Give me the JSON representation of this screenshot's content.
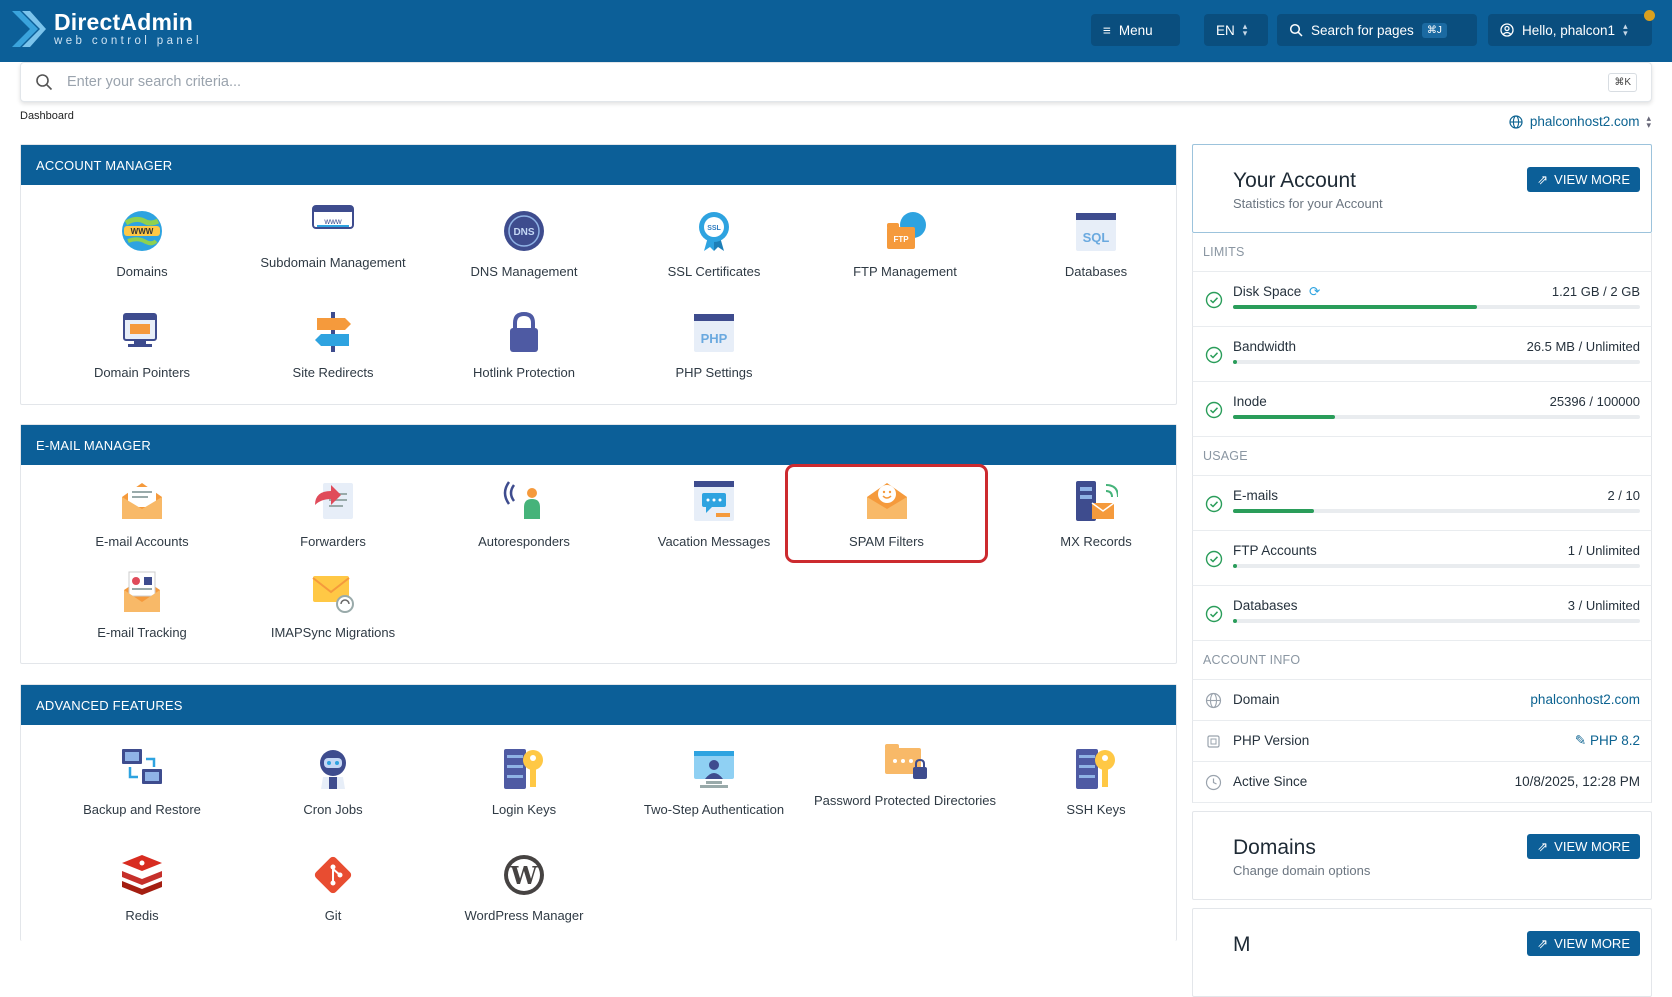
{
  "brand": {
    "name": "DirectAdmin",
    "tagline": "web control panel"
  },
  "topbar": {
    "menu_label": "Menu",
    "lang": "EN",
    "search_label": "Search for pages",
    "search_shortcut": "⌘J",
    "user_label": "Hello, phalcon1"
  },
  "search": {
    "placeholder": "Enter your search criteria...",
    "shortcut": "⌘K"
  },
  "breadcrumb": "Dashboard",
  "domain_select": "phalconhost2.com",
  "account_manager": {
    "title": "ACCOUNT MANAGER",
    "items": [
      {
        "label": "Domains",
        "icon": "www-globe-icon"
      },
      {
        "label": "Subdomain Management",
        "icon": "subdomain-icon"
      },
      {
        "label": "DNS Management",
        "icon": "dns-icon"
      },
      {
        "label": "SSL Certificates",
        "icon": "ssl-badge-icon"
      },
      {
        "label": "FTP Management",
        "icon": "ftp-folder-icon"
      },
      {
        "label": "Databases",
        "icon": "sql-database-icon"
      },
      {
        "label": "Domain Pointers",
        "icon": "domain-pointer-icon"
      },
      {
        "label": "Site Redirects",
        "icon": "signpost-icon"
      },
      {
        "label": "Hotlink Protection",
        "icon": "padlock-icon"
      },
      {
        "label": "PHP Settings",
        "icon": "php-icon"
      }
    ]
  },
  "email_manager": {
    "title": "E-MAIL MANAGER",
    "items": [
      {
        "label": "E-mail Accounts",
        "icon": "envelope-icon"
      },
      {
        "label": "Forwarders",
        "icon": "forward-icon"
      },
      {
        "label": "Autoresponders",
        "icon": "autoresponder-icon"
      },
      {
        "label": "Vacation Messages",
        "icon": "vacation-message-icon"
      },
      {
        "label": "SPAM Filters",
        "icon": "spam-filter-icon"
      },
      {
        "label": "MX Records",
        "icon": "mx-server-icon"
      },
      {
        "label": "E-mail Tracking",
        "icon": "email-tracking-icon"
      },
      {
        "label": "IMAPSync Migrations",
        "icon": "imapsync-icon"
      }
    ]
  },
  "advanced": {
    "title": "ADVANCED FEATURES",
    "items": [
      {
        "label": "Backup and Restore",
        "icon": "backup-icon"
      },
      {
        "label": "Cron Jobs",
        "icon": "cron-robot-icon"
      },
      {
        "label": "Login Keys",
        "icon": "login-key-icon"
      },
      {
        "label": "Two-Step Authentication",
        "icon": "two-step-icon"
      },
      {
        "label": "Password Protected Directories",
        "icon": "protected-folder-icon"
      },
      {
        "label": "SSH Keys",
        "icon": "ssh-key-icon"
      },
      {
        "label": "Redis",
        "icon": "redis-icon"
      },
      {
        "label": "Git",
        "icon": "git-icon"
      },
      {
        "label": "WordPress Manager",
        "icon": "wordpress-icon"
      }
    ]
  },
  "account": {
    "title": "Your Account",
    "subtitle": "Statistics for your Account",
    "view_more": "VIEW MORE"
  },
  "limits": {
    "title": "LIMITS",
    "rows": [
      {
        "name": "Disk Space",
        "value": "1.21 GB / 2 GB",
        "fill": 0.6
      },
      {
        "name": "Bandwidth",
        "value": "26.5 MB / Unlimited",
        "fill": 0.01
      },
      {
        "name": "Inode",
        "value": "25396 / 100000",
        "fill": 0.25
      }
    ]
  },
  "usage": {
    "title": "USAGE",
    "rows": [
      {
        "name": "E-mails",
        "value": "2 / 10",
        "fill": 0.2
      },
      {
        "name": "FTP Accounts",
        "value": "1 / Unlimited",
        "fill": 0.01
      },
      {
        "name": "Databases",
        "value": "3 / Unlimited",
        "fill": 0.01
      }
    ]
  },
  "account_info": {
    "title": "ACCOUNT INFO",
    "rows": [
      {
        "name": "Domain",
        "value": "phalconhost2.com"
      },
      {
        "name": "PHP Version",
        "value": "PHP 8.2"
      },
      {
        "name": "Active Since",
        "value": "10/8/2025, 12:28 PM"
      }
    ]
  },
  "domains_card": {
    "title": "Domains",
    "subtitle": "Change domain options",
    "view_more": "VIEW MORE"
  },
  "next_card": {
    "title": "M",
    "view_more": "VIEW MORE"
  },
  "colors": {
    "primary": "#0c5f98",
    "accent_link": "#0c6391",
    "success": "#2a9d5a",
    "highlight": "#cc2a2f"
  }
}
